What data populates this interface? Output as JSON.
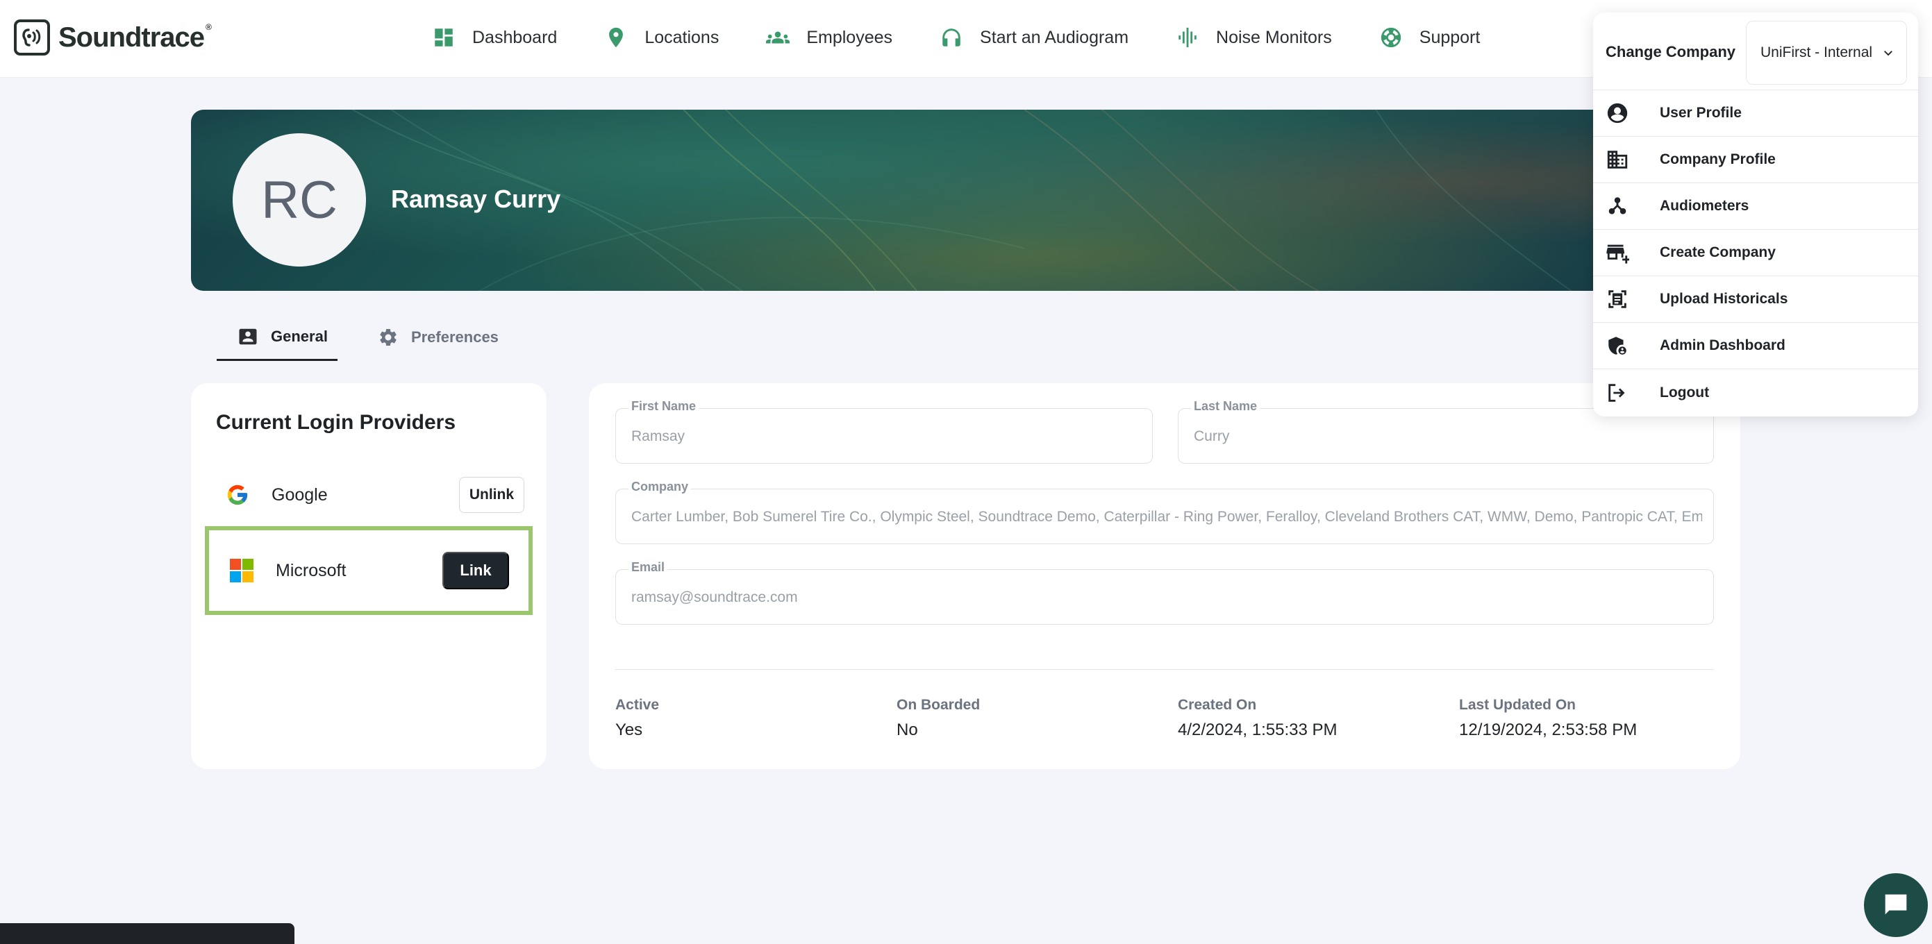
{
  "brand": {
    "name": "Soundtrace",
    "reg_mark": "®"
  },
  "nav": {
    "items": [
      {
        "label": "Dashboard",
        "icon": "dashboard-icon"
      },
      {
        "label": "Locations",
        "icon": "location-pin-icon"
      },
      {
        "label": "Employees",
        "icon": "people-icon"
      },
      {
        "label": "Start an Audiogram",
        "icon": "headphones-icon"
      },
      {
        "label": "Noise Monitors",
        "icon": "sound-wave-icon"
      },
      {
        "label": "Support",
        "icon": "lifebuoy-icon"
      }
    ]
  },
  "profile": {
    "initials": "RC",
    "name": "Ramsay Curry"
  },
  "tabs": [
    {
      "label": "General",
      "icon": "contact-card-icon",
      "active": true
    },
    {
      "label": "Preferences",
      "icon": "gear-icon",
      "active": false
    }
  ],
  "providers": {
    "title": "Current Login Providers",
    "items": [
      {
        "name": "Google",
        "action": "Unlink",
        "icon": "google-icon"
      },
      {
        "name": "Microsoft",
        "action": "Link",
        "icon": "microsoft-icon"
      }
    ]
  },
  "details": {
    "first_name": {
      "label": "First Name",
      "value": "Ramsay"
    },
    "last_name": {
      "label": "Last Name",
      "value": "Curry"
    },
    "company": {
      "label": "Company",
      "value": "Carter Lumber, Bob Sumerel Tire Co., Olympic Steel, Soundtrace Demo, Caterpillar - Ring Power, Feralloy, Cleveland Brothers CAT, WMW, Demo, Pantropic CAT, Em"
    },
    "email": {
      "label": "Email",
      "value": "ramsay@soundtrace.com"
    },
    "stats": [
      {
        "label": "Active",
        "value": "Yes"
      },
      {
        "label": "On Boarded",
        "value": "No"
      },
      {
        "label": "Created On",
        "value": "4/2/2024, 1:55:33 PM"
      },
      {
        "label": "Last Updated On",
        "value": "12/19/2024, 2:53:58 PM"
      }
    ]
  },
  "dropdown": {
    "change_company_label": "Change Company",
    "selected_company": "UniFirst - Internal",
    "items": [
      {
        "label": "User Profile",
        "icon": "account-circle-icon"
      },
      {
        "label": "Company Profile",
        "icon": "building-icon"
      },
      {
        "label": "Audiometers",
        "icon": "hub-icon"
      },
      {
        "label": "Create Company",
        "icon": "store-add-icon"
      },
      {
        "label": "Upload Historicals",
        "icon": "document-scan-icon"
      },
      {
        "label": "Admin Dashboard",
        "icon": "admin-shield-icon"
      },
      {
        "label": "Logout",
        "icon": "logout-icon"
      }
    ]
  },
  "toast": {
    "text": ""
  },
  "colors": {
    "accent": "#3a9a6c",
    "banner": "#1c5550",
    "link_button": "#20262d",
    "highlight": "#9bc66e"
  }
}
